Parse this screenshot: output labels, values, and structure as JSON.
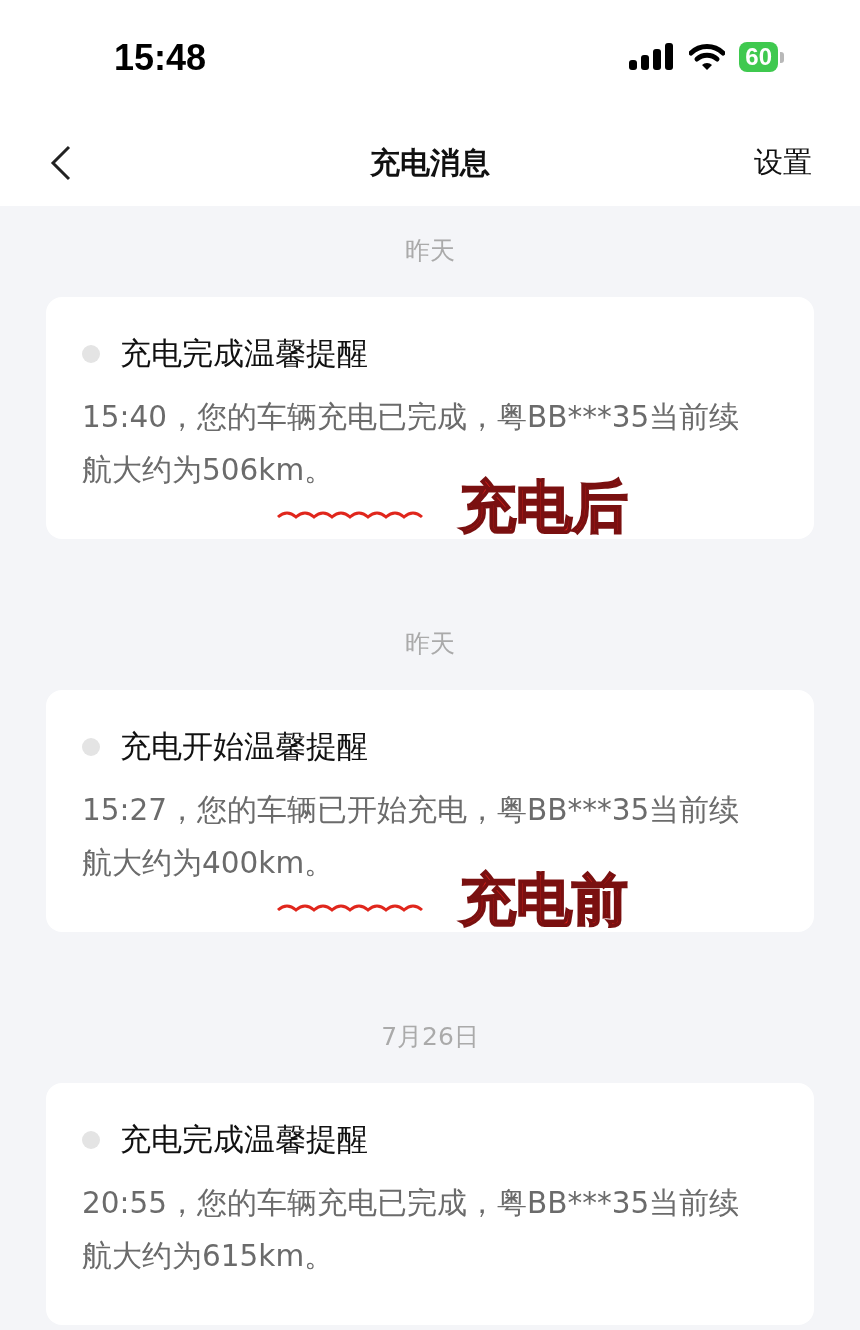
{
  "status_bar": {
    "time": "15:48",
    "battery": "60"
  },
  "nav": {
    "title": "充电消息",
    "action": "设置"
  },
  "messages": [
    {
      "date": "昨天",
      "title": "充电完成温馨提醒",
      "body": "15:40，您的车辆充电已完成，粤BB***35当前续航大约为506km。",
      "annotation": "充电后"
    },
    {
      "date": "昨天",
      "title": "充电开始温馨提醒",
      "body": "15:27，您的车辆已开始充电，粤BB***35当前续航大约为400km。",
      "annotation": "充电前"
    },
    {
      "date": "7月26日",
      "title": "充电完成温馨提醒",
      "body": "20:55，您的车辆充电已完成，粤BB***35当前续航大约为615km。"
    }
  ]
}
